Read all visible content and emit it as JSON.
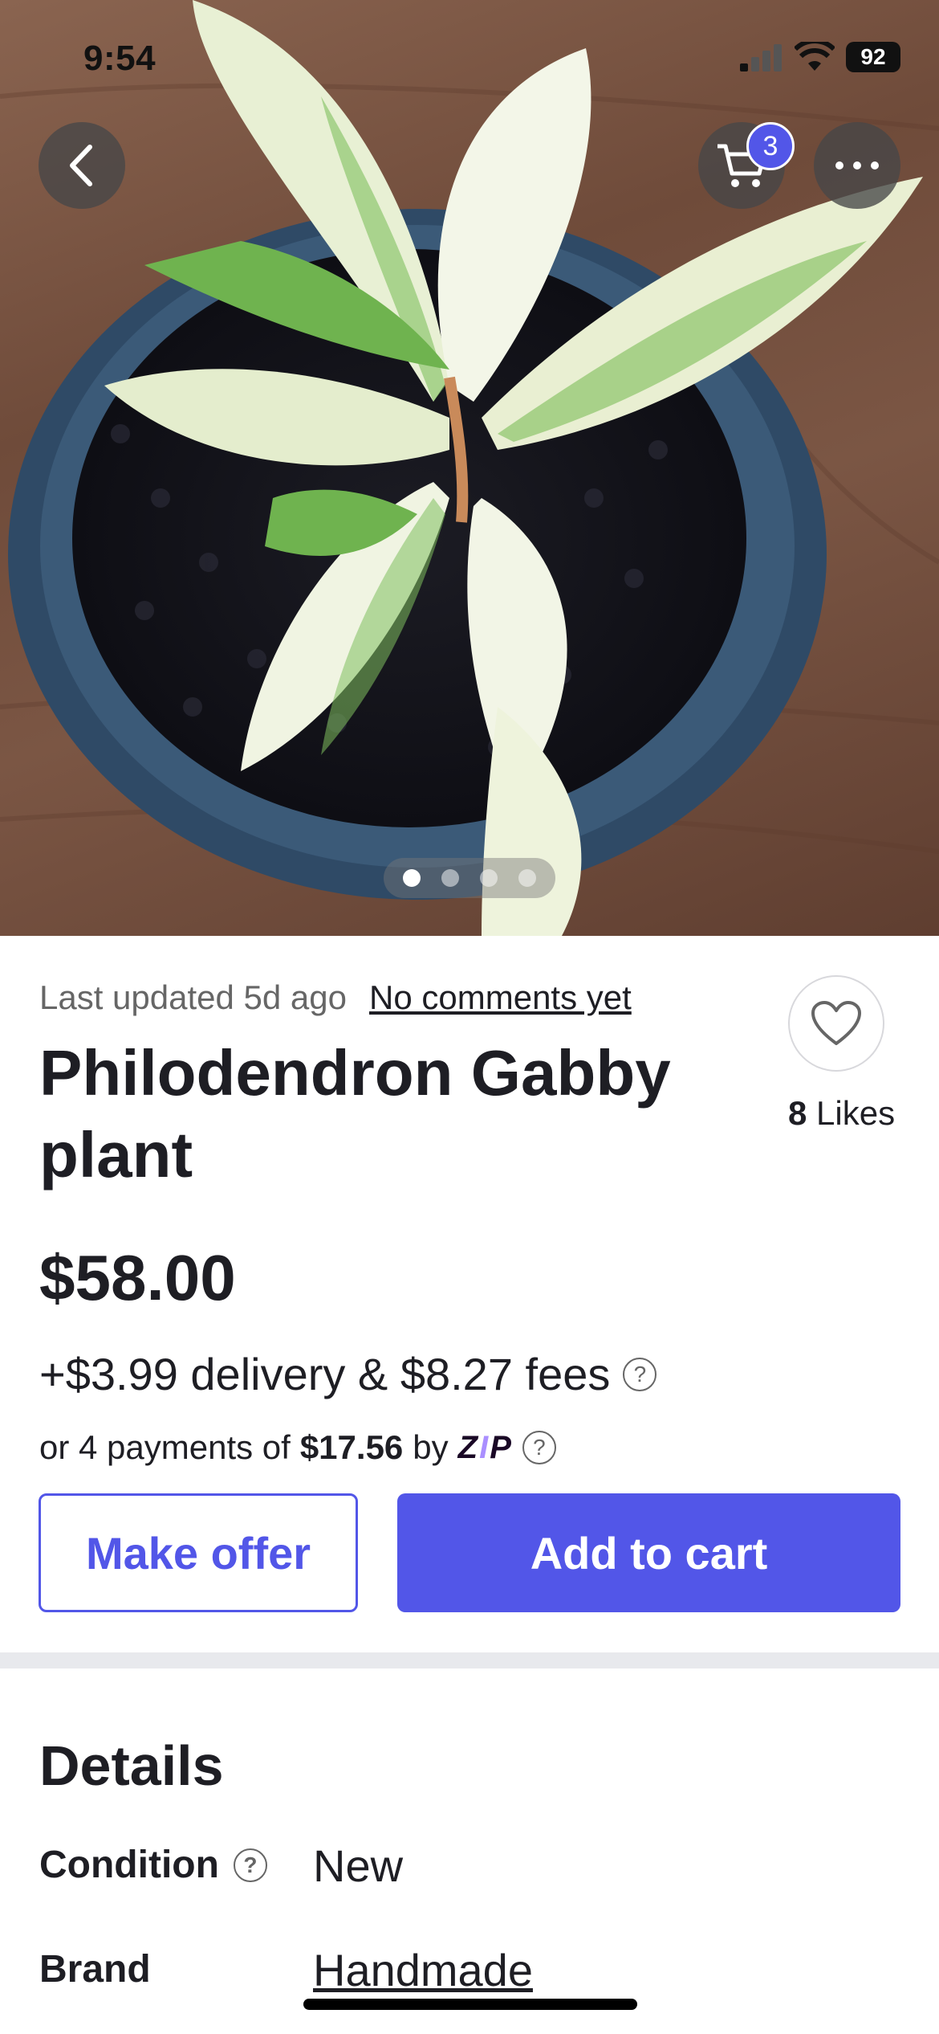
{
  "status_bar": {
    "time": "9:54",
    "battery": "92"
  },
  "header": {
    "cart_count": "3",
    "back_icon": "chevron-left-icon",
    "cart_icon": "cart-icon",
    "more_icon": "ellipsis-icon"
  },
  "gallery": {
    "image_count": 4,
    "active_index": 0
  },
  "listing": {
    "last_updated": "Last updated 5d ago",
    "comments_link": "No comments yet",
    "likes_count": "8",
    "likes_label": "Likes",
    "title": "Philodendron Gabby plant",
    "price": "$58.00",
    "fees": "+$3.99 delivery & $8.27 fees",
    "installments_prefix": "or 4 payments of",
    "installments_amount": "$17.56",
    "installments_by": "by",
    "zip_logo": "zip"
  },
  "actions": {
    "make_offer": "Make offer",
    "add_to_cart": "Add to cart"
  },
  "details": {
    "heading": "Details",
    "condition_label": "Condition",
    "condition_value": "New",
    "brand_label": "Brand",
    "brand_value": "Handmade"
  },
  "colors": {
    "accent": "#5256e8",
    "text": "#1e1e24",
    "muted": "#666666",
    "divider": "#e8e9ed"
  }
}
